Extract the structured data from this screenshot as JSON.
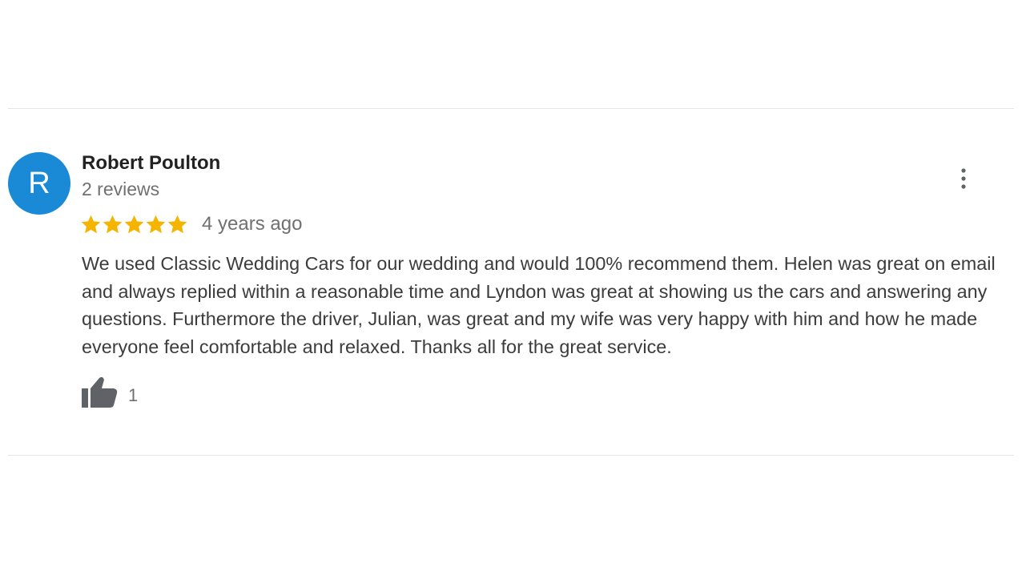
{
  "review": {
    "avatar_letter": "R",
    "author_name": "Robert Poulton",
    "review_count": "2 reviews",
    "rating": 5,
    "max_rating": 5,
    "time_ago": "4 years ago",
    "text": "We used Classic Wedding Cars for our wedding and would 100% recommend them. Helen was great on email and always replied within a reasonable time and Lyndon was great at showing us the cars and answering any questions. Furthermore the driver, Julian, was great and my wife was very happy with him and how he made everyone feel comfortable and relaxed. Thanks all for the great service.",
    "likes": "1"
  },
  "icons": {
    "more": "more-vert-icon",
    "like": "thumbs-up-icon",
    "star": "star-icon"
  },
  "colors": {
    "avatar": "#1a8ad6",
    "star": "#f4b400",
    "icon": "#5f6368"
  }
}
